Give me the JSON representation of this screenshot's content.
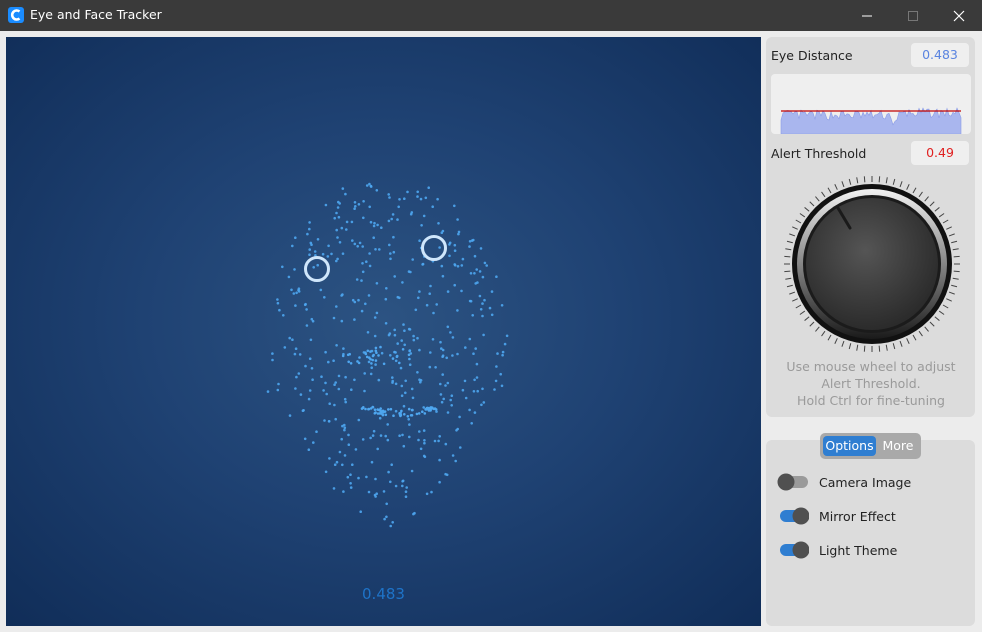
{
  "window": {
    "title": "Eye and Face Tracker",
    "controls": [
      "minimize",
      "maximize",
      "close"
    ]
  },
  "camera_view": {
    "overlay_value": "0.483",
    "landmark_color": "#4ea6ef",
    "eye_marker_color": "#cfe6fb"
  },
  "metrics": {
    "eye_distance_label": "Eye Distance",
    "eye_distance_value": "0.483",
    "eye_distance_color": "#5a84e0",
    "alert_threshold_label": "Alert Threshold",
    "alert_threshold_value": "0.49",
    "alert_threshold_color": "#e02020"
  },
  "history_graph": {
    "threshold_line_color": "#c00000",
    "fill_color": "#a9b6ee",
    "threshold": 0.49
  },
  "knob": {
    "value": 0.49
  },
  "hint": {
    "line1": "Use mouse wheel to adjust",
    "line2": "Alert Threshold.",
    "line3": "Hold Ctrl for fine-tuning"
  },
  "tabs": {
    "options": "Options",
    "more": "More",
    "active": "Options"
  },
  "toggles": [
    {
      "label": "Camera Image",
      "on": false
    },
    {
      "label": "Mirror Effect",
      "on": true
    },
    {
      "label": "Light Theme",
      "on": true
    }
  ],
  "colors": {
    "accent": "#2f7ed1",
    "titlebar": "#3a3a3a",
    "camera_bg": "#1f4273"
  }
}
